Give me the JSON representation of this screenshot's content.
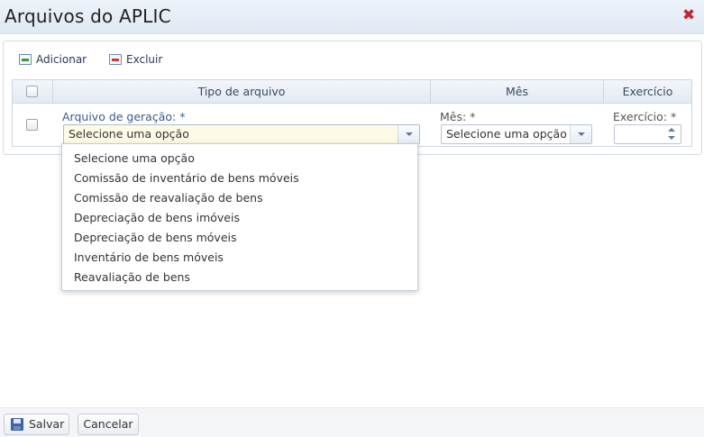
{
  "dialog": {
    "title": "Arquivos do APLIC",
    "close_symbol": "✖"
  },
  "toolbar": {
    "add_label": "Adicionar",
    "delete_label": "Excluir"
  },
  "grid": {
    "columns": [
      "Tipo de arquivo",
      "Mês",
      "Exercício"
    ],
    "row": {
      "tipo_label": "Arquivo de geração: *",
      "tipo_value": "Selecione uma opção",
      "mes_label": "Mês: *",
      "mes_value": "Selecione uma opção",
      "exercicio_label": "Exercício: *",
      "exercicio_value": ""
    }
  },
  "dropdown": {
    "options": [
      "Selecione uma opção",
      "Comissão de inventário de bens móveis",
      "Comissão de reavaliação de bens",
      "Depreciação de bens imóveis",
      "Depreciação de bens móveis",
      "Inventário de bens móveis",
      "Reavaliação de bens"
    ]
  },
  "footer": {
    "save_label": "Salvar",
    "cancel_label": "Cancelar"
  },
  "colors": {
    "title_bar": "#e6edf6",
    "close": "#c8232c",
    "link": "#3b5d8a",
    "save_icon": "#3f61a6"
  }
}
